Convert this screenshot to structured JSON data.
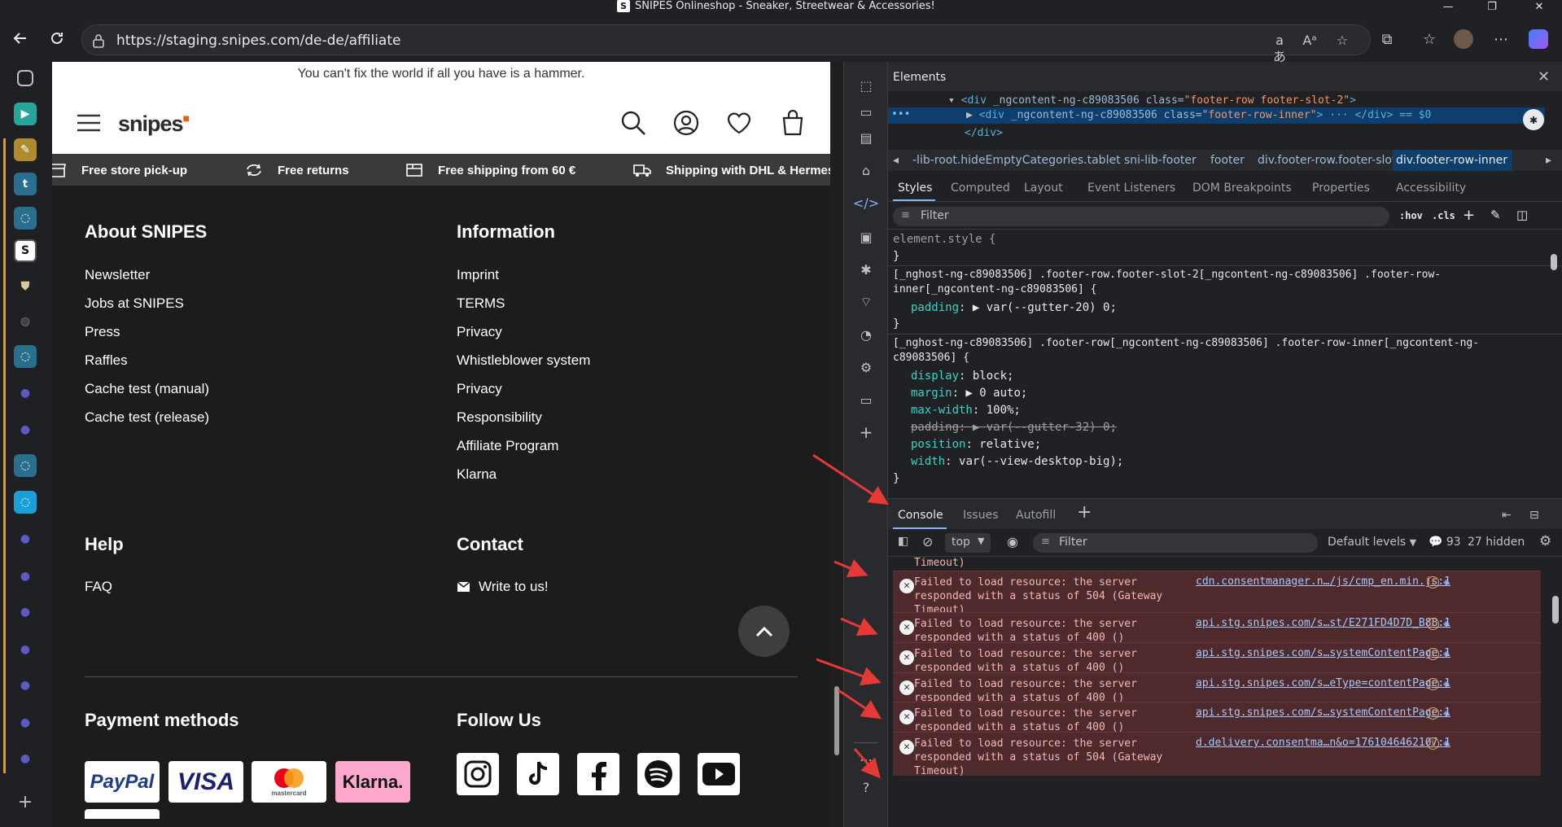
{
  "window": {
    "title": "SNIPES Onlineshop - Sneaker, Streetwear & Accessories!",
    "favicon_letter": "S"
  },
  "browser": {
    "url": "https://staging.snipes.com/de-de/affiliate"
  },
  "page": {
    "quote": "You can't fix the world if all you have is a hammer.",
    "logo_text": "snipes",
    "usp": [
      "Free store pick-up",
      "Free returns",
      "Free shipping from 60 €",
      "Shipping with DHL & Hermes"
    ],
    "footer": {
      "about_title": "About SNIPES",
      "about_links": [
        "Newsletter",
        "Jobs at SNIPES",
        "Press",
        "Raffles",
        "Cache test (manual)",
        "Cache test (release)"
      ],
      "info_title": "Information",
      "info_links": [
        "Imprint",
        "TERMS",
        "Privacy",
        "Whistleblower system",
        "Privacy",
        "Responsibility",
        "Affiliate Program",
        "Klarna"
      ],
      "help_title": "Help",
      "help_links": [
        "FAQ"
      ],
      "contact_title": "Contact",
      "contact_link": "Write to us!",
      "payment_title": "Payment methods",
      "payment_methods": [
        "PayPal",
        "VISA",
        "mastercard",
        "Klarna."
      ],
      "follow_title": "Follow Us",
      "social": [
        "instagram-icon",
        "tiktok-icon",
        "facebook-icon",
        "spotify-icon",
        "youtube-icon"
      ]
    }
  },
  "devtools": {
    "panel_title": "Elements",
    "dom_lines": [
      {
        "tag": "<div",
        "attr": " _ngcontent-ng-c89083506 class=",
        "val": "\"footer-row footer-slot-2\"",
        "end": ">"
      },
      {
        "tag": "<div",
        "attr": " _ngcontent-ng-c89083506 class=",
        "val": "\"footer-row-inner\"",
        "end": "> ··· </div> == $0"
      },
      {
        "tag": "</div>",
        "attr": "",
        "val": "",
        "end": ""
      }
    ],
    "breadcrumbs": [
      "-lib-root.hideEmptyCategories.tablet",
      "sni-lib-footer",
      "footer",
      "div.footer-row.footer-slot-2",
      "div.footer-row-inner"
    ],
    "style_tabs": [
      "Styles",
      "Computed",
      "Layout",
      "Event Listeners",
      "DOM Breakpoints",
      "Properties",
      "Accessibility"
    ],
    "filter_placeholder": "Filter",
    "hov": ":hov",
    "cls": ".cls",
    "styles": {
      "element_style": "element.style {",
      "close": "}",
      "rule1_selector_a": "[_nghost-ng-c89083506] .footer-row.footer-slot-2[_ngcontent-ng-c89083506] .footer-row-",
      "rule1_selector_b": "inner[_ngcontent-ng-c89083506] {",
      "rule1_prop": "padding",
      "rule1_val": "var(--gutter-20) 0;",
      "rule2_selector_a": "[_nghost-ng-c89083506] .footer-row[_ngcontent-ng-c89083506] .footer-row-inner[_ngcontent-ng-",
      "rule2_selector_b": "c89083506] {",
      "rule2_props": [
        {
          "p": "display",
          "v": "block;",
          "strike": false
        },
        {
          "p": "margin",
          "v": "0 auto;",
          "strike": false
        },
        {
          "p": "max-width",
          "v": "100%;",
          "strike": false
        },
        {
          "p": "padding",
          "v": "var(--gutter-32) 0;",
          "strike": true
        },
        {
          "p": "position",
          "v": "relative;",
          "strike": false
        },
        {
          "p": "width",
          "v": "var(--view-desktop-big);",
          "strike": false
        }
      ]
    },
    "console_tabs": [
      "Console",
      "Issues",
      "Autofill"
    ],
    "console_toolbar": {
      "context": "top",
      "filter": "Filter",
      "levels": "Default levels",
      "issues_count": "93",
      "hidden": "27 hidden"
    },
    "console_partial": "Timeout)",
    "errors": [
      {
        "msg": [
          "Failed to load resource: the server",
          "responded with a status of 504 (Gateway",
          "Timeout)"
        ],
        "link": "cdn.consentmanager.n…/js/cmp_en.min.js:1"
      },
      {
        "msg": [
          "Failed to load resource: the server",
          "responded with a status of 400 ()"
        ],
        "link": "api.stg.snipes.com/s…st/E271FD4D7D_B88:1"
      },
      {
        "msg": [
          "Failed to load resource: the server",
          "responded with a status of 400 ()"
        ],
        "link": "api.stg.snipes.com/s…systemContentPage:1"
      },
      {
        "msg": [
          "Failed to load resource: the server",
          "responded with a status of 400 ()"
        ],
        "link": "api.stg.snipes.com/s…eType=contentPage:1"
      },
      {
        "msg": [
          "Failed to load resource: the server",
          "responded with a status of 400 ()"
        ],
        "link": "api.stg.snipes.com/s…systemContentPage:1"
      },
      {
        "msg": [
          "Failed to load resource: the server",
          "responded with a status of 504 (Gateway",
          "Timeout)"
        ],
        "link": "d.delivery.consentma…n&o=1761046462107:1"
      }
    ]
  },
  "colors": {
    "accent": "#ff5a00",
    "annotation_arrow": "#e53935",
    "error_bg": "#4e2a2c"
  }
}
